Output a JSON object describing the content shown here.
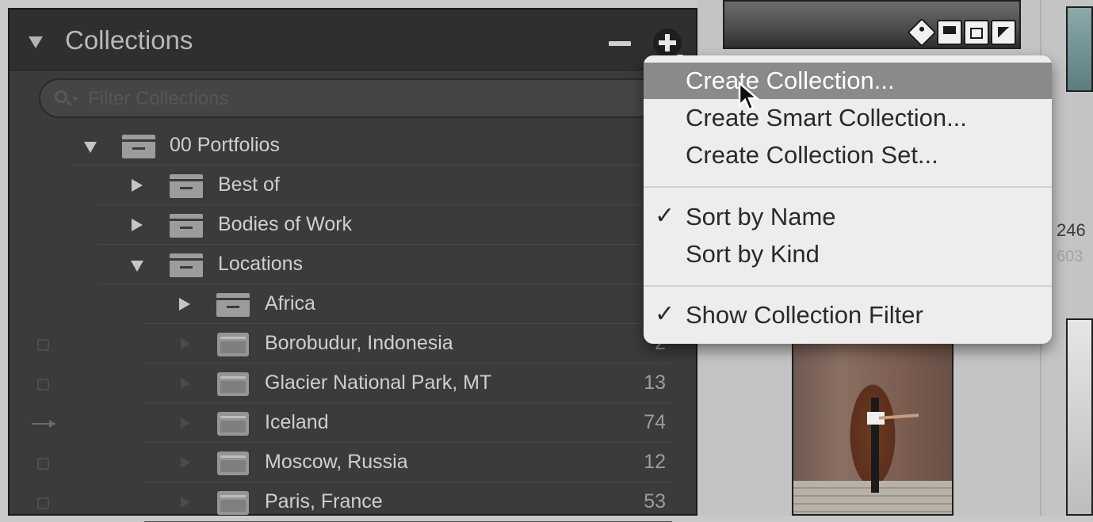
{
  "panel": {
    "title": "Collections",
    "filter_placeholder": "Filter Collections"
  },
  "tree": [
    {
      "label": "00 Portfolios",
      "count": "",
      "type": "set",
      "expanded": true
    },
    {
      "label": "Best of",
      "count": "",
      "type": "set",
      "expanded": false
    },
    {
      "label": "Bodies of Work",
      "count": "",
      "type": "set",
      "expanded": false
    },
    {
      "label": "Locations",
      "count": "",
      "type": "set",
      "expanded": true
    },
    {
      "label": "Africa",
      "count": "",
      "type": "set",
      "expanded": false
    },
    {
      "label": "Borobudur, Indonesia",
      "count": "2",
      "type": "collection"
    },
    {
      "label": "Glacier National Park, MT",
      "count": "13",
      "type": "collection"
    },
    {
      "label": "Iceland",
      "count": "74",
      "type": "collection"
    },
    {
      "label": "Moscow, Russia",
      "count": "12",
      "type": "collection"
    },
    {
      "label": "Paris, France",
      "count": "53",
      "type": "collection"
    }
  ],
  "menu": {
    "items": [
      {
        "label": "Create Collection...",
        "checked": false,
        "highlighted": true
      },
      {
        "label": "Create Smart Collection...",
        "checked": false
      },
      {
        "label": "Create Collection Set...",
        "checked": false
      },
      {
        "label": "Sort by Name",
        "checked": true
      },
      {
        "label": "Sort by Kind",
        "checked": false
      },
      {
        "label": "Show Collection Filter",
        "checked": true
      }
    ],
    "check_glyph": "✓"
  },
  "grid": {
    "cell_number": "246",
    "cell_number_2": "603"
  },
  "colors": {
    "panel_bg": "#3b3b3b",
    "header_bg": "#2f2f2f",
    "menu_bg": "#ededed",
    "menu_highlight": "#8a8a8a"
  },
  "icons": {
    "panel_collapse": "triangle-down-icon",
    "remove": "minus-icon",
    "add": "plus-icon",
    "set": "collection-set-icon",
    "collection": "collection-icon",
    "check": "checkmark-icon"
  }
}
